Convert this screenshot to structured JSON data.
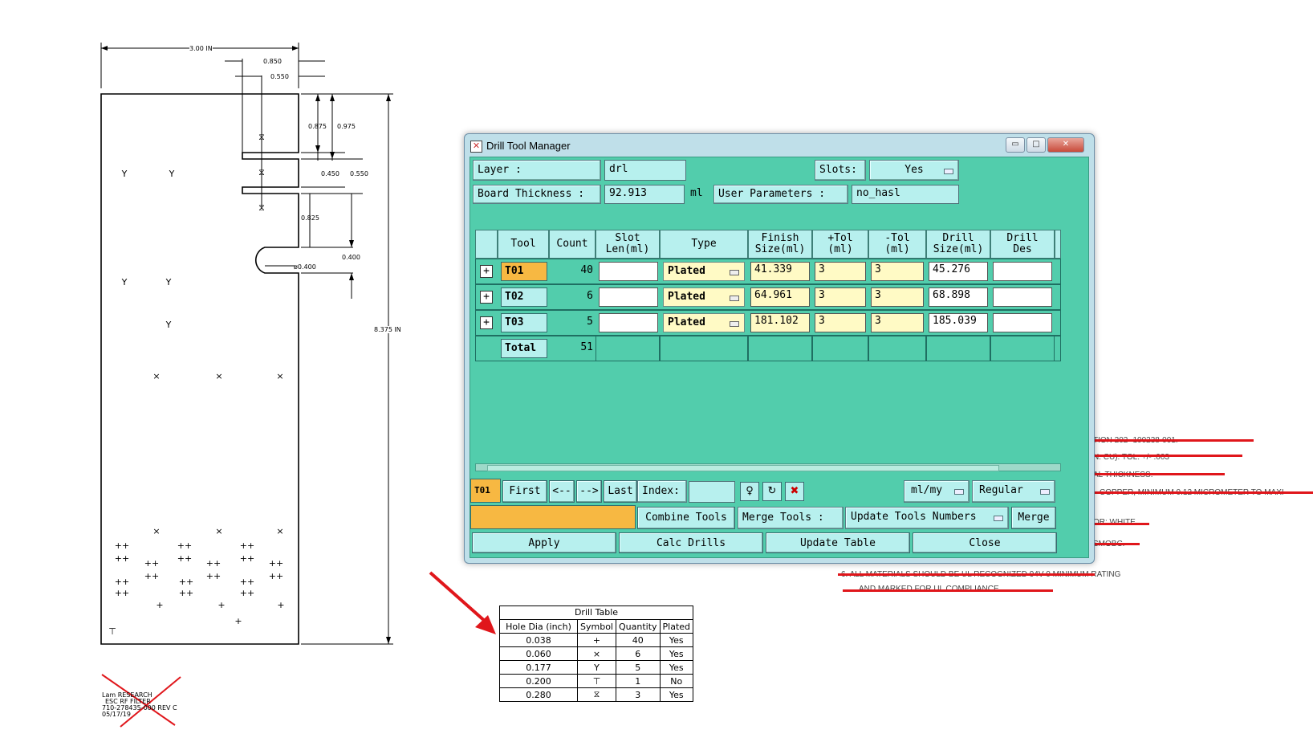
{
  "drawing": {
    "dimensions": [
      "3.00 IN",
      "0.850",
      "0.550",
      "0.875",
      "0.975",
      "0.450",
      "0.550",
      "0.825",
      "0.400",
      "ø0.400",
      "8.375 IN"
    ],
    "title_block": [
      "Lam RESEARCH",
      "ESC RF FILTER",
      "710-278435-000 REV C",
      "05/17/19"
    ],
    "notes": [
      "TION 202 -100238-001.",
      "N. CU).  TOL: +/- .003",
      "AL THICKNESS.",
      "COPPER, MINIMUM 0.12 MICROMETER TO MAXI",
      "OR: WHITE",
      "SMOBC.",
      "6.  ALL MATERIALS SHOULD BE UL RECOGNIZED 94V-0 MINIMUM RATING",
      "AND MARKED FOR UL COMPLIANCE."
    ]
  },
  "drill_table": {
    "title": "Drill Table",
    "headers": [
      "Hole Dia (inch)",
      "Symbol",
      "Quantity",
      "Plated"
    ],
    "rows": [
      {
        "dia": "0.038",
        "symbol": "+",
        "qty": "40",
        "plated": "Yes"
      },
      {
        "dia": "0.060",
        "symbol": "×",
        "qty": "6",
        "plated": "Yes"
      },
      {
        "dia": "0.177",
        "symbol": "Y",
        "qty": "5",
        "plated": "Yes"
      },
      {
        "dia": "0.200",
        "symbol": "⊤",
        "qty": "1",
        "plated": "No"
      },
      {
        "dia": "0.280",
        "symbol": "⧖",
        "qty": "3",
        "plated": "Yes"
      }
    ]
  },
  "window": {
    "title": "Drill Tool Manager",
    "controls": {
      "minimize": "▭",
      "maximize": "□",
      "close": "✕"
    },
    "layer_label": "Layer         :",
    "layer_value": "drl",
    "slots_label": "Slots:",
    "slots_value": "Yes",
    "thickness_label": "Board Thickness :",
    "thickness_value": "92.913",
    "thickness_unit": "ml",
    "user_params_label": "User Parameters :",
    "user_params_value": "no_hasl",
    "table": {
      "headers": [
        {
          "l1": "Tool",
          "l2": ""
        },
        {
          "l1": "Count",
          "l2": ""
        },
        {
          "l1": "Slot",
          "l2": "Len(ml)"
        },
        {
          "l1": "Type",
          "l2": ""
        },
        {
          "l1": "Finish",
          "l2": "Size(ml)"
        },
        {
          "l1": "+Tol",
          "l2": "(ml)"
        },
        {
          "l1": "-Tol",
          "l2": "(ml)"
        },
        {
          "l1": "Drill",
          "l2": "Size(ml)"
        },
        {
          "l1": "Drill",
          "l2": "Des"
        }
      ],
      "rows": [
        {
          "tool": "T01",
          "count": "40",
          "slot": "",
          "type": "Plated",
          "finish": "41.339",
          "plus": "3",
          "minus": "3",
          "drill": "45.276",
          "des": ""
        },
        {
          "tool": "T02",
          "count": "6",
          "slot": "",
          "type": "Plated",
          "finish": "64.961",
          "plus": "3",
          "minus": "3",
          "drill": "68.898",
          "des": ""
        },
        {
          "tool": "T03",
          "count": "5",
          "slot": "",
          "type": "Plated",
          "finish": "181.102",
          "plus": "3",
          "minus": "3",
          "drill": "185.039",
          "des": ""
        }
      ],
      "total_label": "Total",
      "total_count": "51"
    },
    "nav": {
      "current_tool": "T01",
      "first": "First",
      "prev": "<--",
      "next": "-->",
      "last": "Last",
      "index_label": "Index:",
      "index_value": "",
      "units": "ml/my",
      "mode": "Regular"
    },
    "actions": {
      "combine_tools": "Combine Tools",
      "merge_tools_label": "Merge Tools :",
      "update_tools_numbers": "Update Tools Numbers",
      "merge": "Merge",
      "apply": "Apply",
      "calc_drills": "Calc Drills",
      "update_table": "Update Table",
      "close": "Close"
    }
  },
  "colors": {
    "client_bg": "#52cdac",
    "label_bg": "#b7f0ee",
    "selected_tool": "#f7b842",
    "input_yellow": "#fffac5",
    "annotation_red": "#e0161b"
  }
}
